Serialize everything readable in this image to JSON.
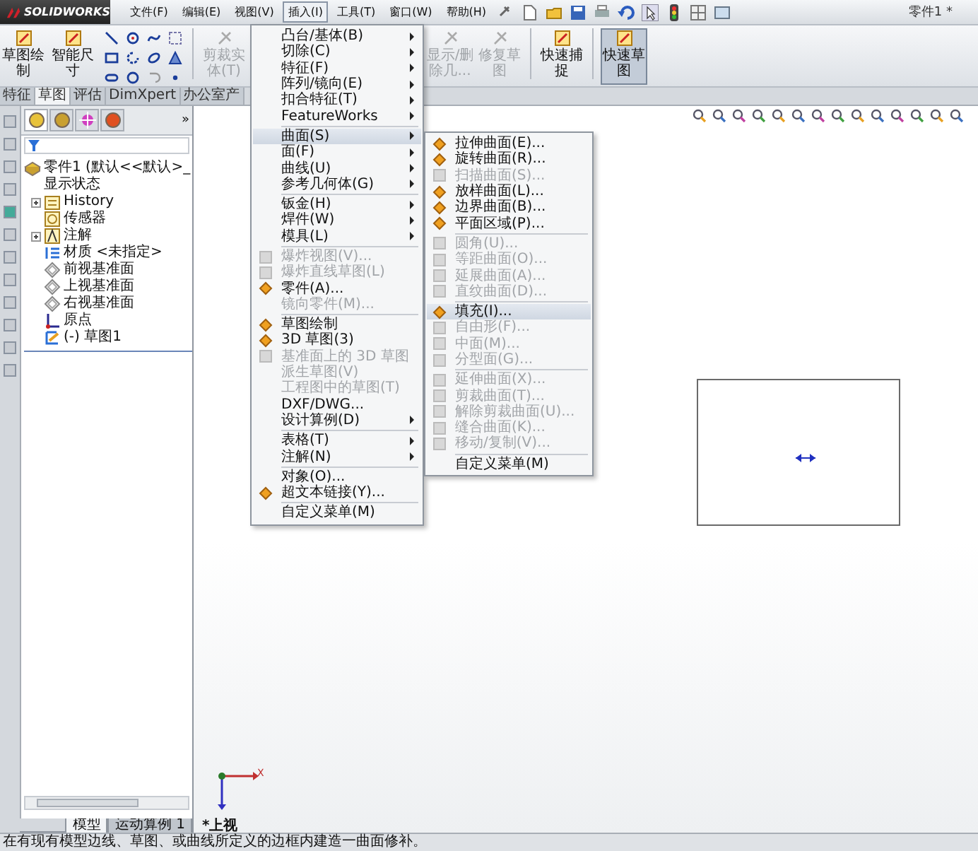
{
  "app": {
    "logo": "SOLIDWORKS",
    "document_title": "零件1 *"
  },
  "menu_bar": [
    {
      "label": "文件(F)",
      "selected": false
    },
    {
      "label": "编辑(E)",
      "selected": false
    },
    {
      "label": "视图(V)",
      "selected": false
    },
    {
      "label": "插入(I)",
      "selected": true
    },
    {
      "label": "工具(T)",
      "selected": false
    },
    {
      "label": "窗口(W)",
      "selected": false
    },
    {
      "label": "帮助(H)",
      "selected": false
    }
  ],
  "ribbon": {
    "left": [
      {
        "kind": "button",
        "lines": [
          "草图绘",
          "制"
        ],
        "disabled": false,
        "selected": false
      },
      {
        "kind": "button",
        "lines": [
          "智能尺",
          "寸"
        ],
        "disabled": false,
        "selected": false
      },
      {
        "kind": "tool_grid"
      },
      {
        "kind": "separator"
      },
      {
        "kind": "button",
        "lines": [
          "剪裁实",
          "体(T)"
        ],
        "disabled": true,
        "selected": false
      }
    ],
    "right": [
      {
        "kind": "button",
        "lines": [
          "显示/删",
          "除几..."
        ],
        "disabled": true,
        "selected": false
      },
      {
        "kind": "button",
        "lines": [
          "修复草",
          "图"
        ],
        "disabled": true,
        "selected": false
      },
      {
        "kind": "separator"
      },
      {
        "kind": "button",
        "lines": [
          "快速捕",
          "捉"
        ],
        "disabled": false,
        "selected": false
      },
      {
        "kind": "separator"
      },
      {
        "kind": "button",
        "lines": [
          "快速草",
          "图"
        ],
        "disabled": false,
        "selected": true
      }
    ]
  },
  "tabs": [
    {
      "label": "特征",
      "selected": false
    },
    {
      "label": "草图",
      "selected": true
    },
    {
      "label": "评估",
      "selected": false
    },
    {
      "label": "DimXpert",
      "selected": false
    },
    {
      "label": "办公室产",
      "selected": false
    }
  ],
  "panel_tabs": [
    {
      "selected": true
    },
    {
      "selected": false
    },
    {
      "selected": false
    },
    {
      "selected": false
    }
  ],
  "feature_tree": {
    "collapse_glyph": "»",
    "root": {
      "label": "零件1 (默认<<默认>_显示状态",
      "kind": "part",
      "children": [
        {
          "label": "History",
          "kind": "folder",
          "expandable": true
        },
        {
          "label": "传感器",
          "kind": "sensor",
          "expandable": false
        },
        {
          "label": "注解",
          "kind": "annotation",
          "expandable": true
        },
        {
          "label": "材质 <未指定>",
          "kind": "material",
          "expandable": false
        },
        {
          "label": "前视基准面",
          "kind": "plane",
          "expandable": false
        },
        {
          "label": "上视基准面",
          "kind": "plane",
          "expandable": false
        },
        {
          "label": "右视基准面",
          "kind": "plane",
          "expandable": false
        },
        {
          "label": "原点",
          "kind": "origin",
          "expandable": false
        },
        {
          "label": "(-) 草图1",
          "kind": "sketch",
          "expandable": false
        }
      ]
    }
  },
  "insert_menu": {
    "groups": [
      [
        {
          "label": "凸台/基体(B)",
          "submenu": true,
          "disabled": false,
          "selected": false,
          "icon": false
        },
        {
          "label": "切除(C)",
          "submenu": true,
          "disabled": false,
          "selected": false,
          "icon": false
        },
        {
          "label": "特征(F)",
          "submenu": true,
          "disabled": false,
          "selected": false,
          "icon": false
        },
        {
          "label": "阵列/镜向(E)",
          "submenu": true,
          "disabled": false,
          "selected": false,
          "icon": false
        },
        {
          "label": "扣合特征(T)",
          "submenu": true,
          "disabled": false,
          "selected": false,
          "icon": false
        },
        {
          "label": "FeatureWorks",
          "submenu": true,
          "disabled": false,
          "selected": false,
          "icon": false
        }
      ],
      [
        {
          "label": "曲面(S)",
          "submenu": true,
          "disabled": false,
          "selected": true,
          "icon": false
        },
        {
          "label": "面(F)",
          "submenu": true,
          "disabled": false,
          "selected": false,
          "icon": false
        },
        {
          "label": "曲线(U)",
          "submenu": true,
          "disabled": false,
          "selected": false,
          "icon": false
        },
        {
          "label": "参考几何体(G)",
          "submenu": true,
          "disabled": false,
          "selected": false,
          "icon": false
        }
      ],
      [
        {
          "label": "钣金(H)",
          "submenu": true,
          "disabled": false,
          "selected": false,
          "icon": false
        },
        {
          "label": "焊件(W)",
          "submenu": true,
          "disabled": false,
          "selected": false,
          "icon": false
        },
        {
          "label": "模具(L)",
          "submenu": true,
          "disabled": false,
          "selected": false,
          "icon": false
        }
      ],
      [
        {
          "label": "爆炸视图(V)...",
          "submenu": false,
          "disabled": true,
          "selected": false,
          "icon": true
        },
        {
          "label": "爆炸直线草图(L)",
          "submenu": false,
          "disabled": true,
          "selected": false,
          "icon": true
        },
        {
          "label": "零件(A)...",
          "submenu": false,
          "disabled": false,
          "selected": false,
          "icon": true
        },
        {
          "label": "镜向零件(M)...",
          "submenu": false,
          "disabled": true,
          "selected": false,
          "icon": false
        }
      ],
      [
        {
          "label": "草图绘制",
          "submenu": false,
          "disabled": false,
          "selected": false,
          "icon": true
        },
        {
          "label": "3D 草图(3)",
          "submenu": false,
          "disabled": false,
          "selected": false,
          "icon": true
        },
        {
          "label": "基准面上的 3D 草图",
          "submenu": false,
          "disabled": true,
          "selected": false,
          "icon": true
        },
        {
          "label": "派生草图(V)",
          "submenu": false,
          "disabled": true,
          "selected": false,
          "icon": false
        },
        {
          "label": "工程图中的草图(T)",
          "submenu": false,
          "disabled": true,
          "selected": false,
          "icon": false
        },
        {
          "label": "DXF/DWG...",
          "submenu": false,
          "disabled": false,
          "selected": false,
          "icon": false
        },
        {
          "label": "设计算例(D)",
          "submenu": true,
          "disabled": false,
          "selected": false,
          "icon": false
        }
      ],
      [
        {
          "label": "表格(T)",
          "submenu": true,
          "disabled": false,
          "selected": false,
          "icon": false
        },
        {
          "label": "注解(N)",
          "submenu": true,
          "disabled": false,
          "selected": false,
          "icon": false
        }
      ],
      [
        {
          "label": "对象(O)...",
          "submenu": false,
          "disabled": false,
          "selected": false,
          "icon": false
        },
        {
          "label": "超文本链接(Y)...",
          "submenu": false,
          "disabled": false,
          "selected": false,
          "icon": true
        }
      ],
      [
        {
          "label": "自定义菜单(M)",
          "submenu": false,
          "disabled": false,
          "selected": false,
          "icon": false
        }
      ]
    ]
  },
  "surface_submenu": {
    "groups": [
      [
        {
          "label": "拉伸曲面(E)...",
          "disabled": false,
          "selected": false,
          "icon": true
        },
        {
          "label": "旋转曲面(R)...",
          "disabled": false,
          "selected": false,
          "icon": true
        },
        {
          "label": "扫描曲面(S)...",
          "disabled": true,
          "selected": false,
          "icon": true
        },
        {
          "label": "放样曲面(L)...",
          "disabled": false,
          "selected": false,
          "icon": true
        },
        {
          "label": "边界曲面(B)...",
          "disabled": false,
          "selected": false,
          "icon": true
        },
        {
          "label": "平面区域(P)...",
          "disabled": false,
          "selected": false,
          "icon": true
        }
      ],
      [
        {
          "label": "圆角(U)...",
          "disabled": true,
          "selected": false,
          "icon": true
        },
        {
          "label": "等距曲面(O)...",
          "disabled": true,
          "selected": false,
          "icon": true
        },
        {
          "label": "延展曲面(A)...",
          "disabled": true,
          "selected": false,
          "icon": true
        },
        {
          "label": "直纹曲面(D)...",
          "disabled": true,
          "selected": false,
          "icon": true
        }
      ],
      [
        {
          "label": "填充(I)...",
          "disabled": false,
          "selected": true,
          "icon": true
        },
        {
          "label": "自由形(F)...",
          "disabled": true,
          "selected": false,
          "icon": true
        },
        {
          "label": "中面(M)...",
          "disabled": true,
          "selected": false,
          "icon": true
        },
        {
          "label": "分型面(G)...",
          "disabled": true,
          "selected": false,
          "icon": true
        }
      ],
      [
        {
          "label": "延伸曲面(X)...",
          "disabled": true,
          "selected": false,
          "icon": true
        },
        {
          "label": "剪裁曲面(T)...",
          "disabled": true,
          "selected": false,
          "icon": true
        },
        {
          "label": "解除剪裁曲面(U)...",
          "disabled": true,
          "selected": false,
          "icon": true
        },
        {
          "label": "缝合曲面(K)...",
          "disabled": true,
          "selected": false,
          "icon": true
        },
        {
          "label": "移动/复制(V)...",
          "disabled": true,
          "selected": false,
          "icon": true
        }
      ],
      [
        {
          "label": "自定义菜单(M)",
          "disabled": false,
          "selected": false,
          "icon": false
        }
      ]
    ]
  },
  "viewport": {
    "view_name": "*上视",
    "axis_x": "X"
  },
  "bottom_tabs": [
    {
      "label": "模型",
      "selected": true
    },
    {
      "label": "运动算例 1",
      "selected": false
    }
  ],
  "status_bar": {
    "text": "在有现有模型边线、草图、或曲线所定义的边框内建造一曲面修补。"
  }
}
